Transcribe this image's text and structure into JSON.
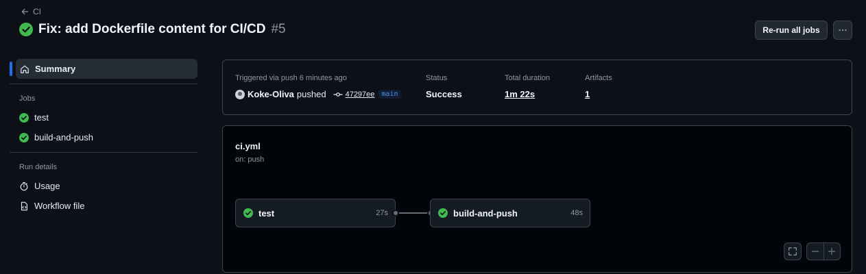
{
  "header": {
    "back_label": "CI",
    "title": "Fix: add Dockerfile content for CI/CD",
    "run_number": "#5",
    "rerun_label": "Re-run all jobs"
  },
  "sidebar": {
    "summary_label": "Summary",
    "jobs_heading": "Jobs",
    "jobs": [
      {
        "label": "test",
        "status": "success"
      },
      {
        "label": "build-and-push",
        "status": "success"
      }
    ],
    "details_heading": "Run details",
    "details": [
      {
        "label": "Usage",
        "icon": "stopwatch-icon"
      },
      {
        "label": "Workflow file",
        "icon": "file-code-icon"
      }
    ]
  },
  "summary": {
    "trigger_label": "Triggered via push 6 minutes ago",
    "actor": "Koke-Oliva",
    "action": "pushed",
    "commit_sha": "47297ee",
    "branch": "main",
    "status_label": "Status",
    "status_value": "Success",
    "duration_label": "Total duration",
    "duration_value": "1m 22s",
    "artifacts_label": "Artifacts",
    "artifacts_value": "1"
  },
  "workflow": {
    "file_name": "ci.yml",
    "trigger": "on: push",
    "jobs": [
      {
        "name": "test",
        "duration": "27s"
      },
      {
        "name": "build-and-push",
        "duration": "48s"
      }
    ]
  },
  "colors": {
    "background": "#0d1117",
    "success": "#3fb950",
    "accent": "#1f6feb",
    "branch_text": "#4493f8"
  }
}
